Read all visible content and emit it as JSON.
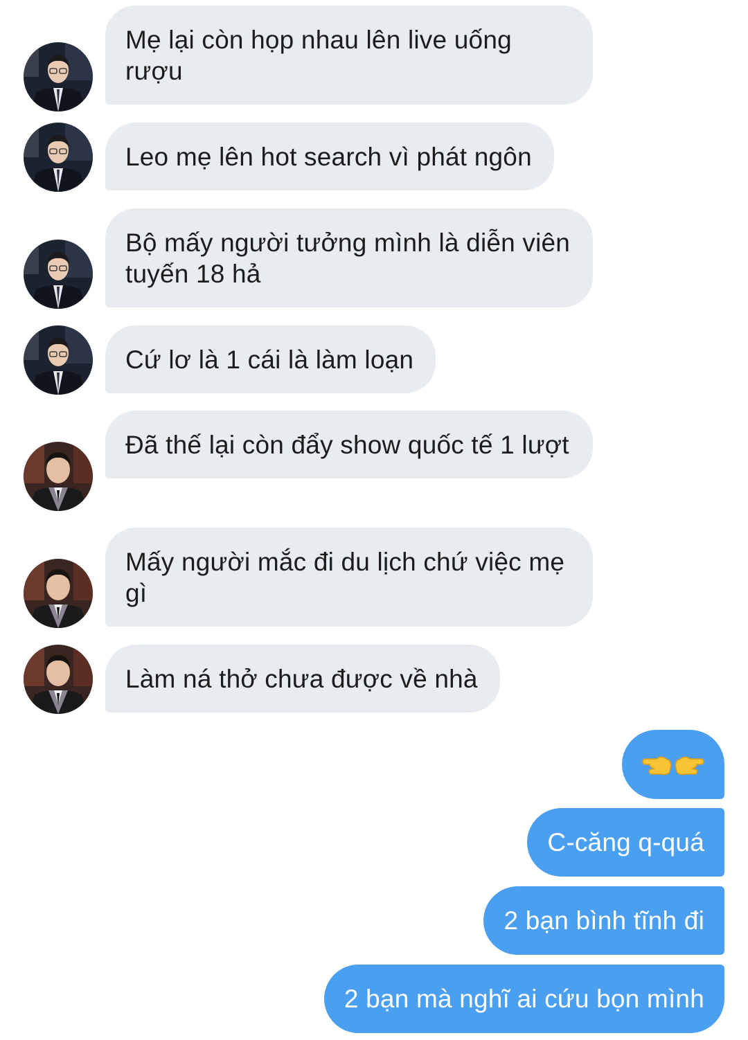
{
  "colors": {
    "incoming_bubble": "#e8ebef",
    "outgoing_bubble": "#4a9ff0",
    "incoming_text": "#1c1c1c",
    "outgoing_text": "#ffffff"
  },
  "messages": [
    {
      "direction": "incoming",
      "sender_avatar": "avatar-glasses-man",
      "text": "Mẹ lại còn họp nhau lên live uống rượu"
    },
    {
      "direction": "incoming",
      "sender_avatar": "avatar-glasses-man",
      "text": "Leo mẹ lên hot search vì phát ngôn"
    },
    {
      "direction": "incoming",
      "sender_avatar": "avatar-glasses-man",
      "text": "Bộ mấy người tưởng mình là diễn viên tuyến 18 hả"
    },
    {
      "direction": "incoming",
      "sender_avatar": "avatar-glasses-man",
      "text": "Cứ lơ là 1 cái là làm loạn"
    },
    {
      "direction": "incoming",
      "sender_avatar": "avatar-vest-man",
      "text": "Đã thế lại còn đẩy show quốc tế 1 lượt"
    },
    {
      "direction": "incoming",
      "sender_avatar": "avatar-vest-man",
      "text": "Mấy người mắc đi du lịch chứ việc mẹ gì"
    },
    {
      "direction": "incoming",
      "sender_avatar": "avatar-vest-man",
      "text": "Làm ná thở chưa được về nhà"
    },
    {
      "direction": "outgoing",
      "emoji": [
        "backhand-pointing-left-emoji",
        "backhand-pointing-right-emoji"
      ]
    },
    {
      "direction": "outgoing",
      "text": "C-căng q-quá"
    },
    {
      "direction": "outgoing",
      "text": "2 bạn bình tĩnh đi"
    },
    {
      "direction": "outgoing",
      "text": "2 bạn mà nghĩ ai cứu bọn mình"
    }
  ]
}
